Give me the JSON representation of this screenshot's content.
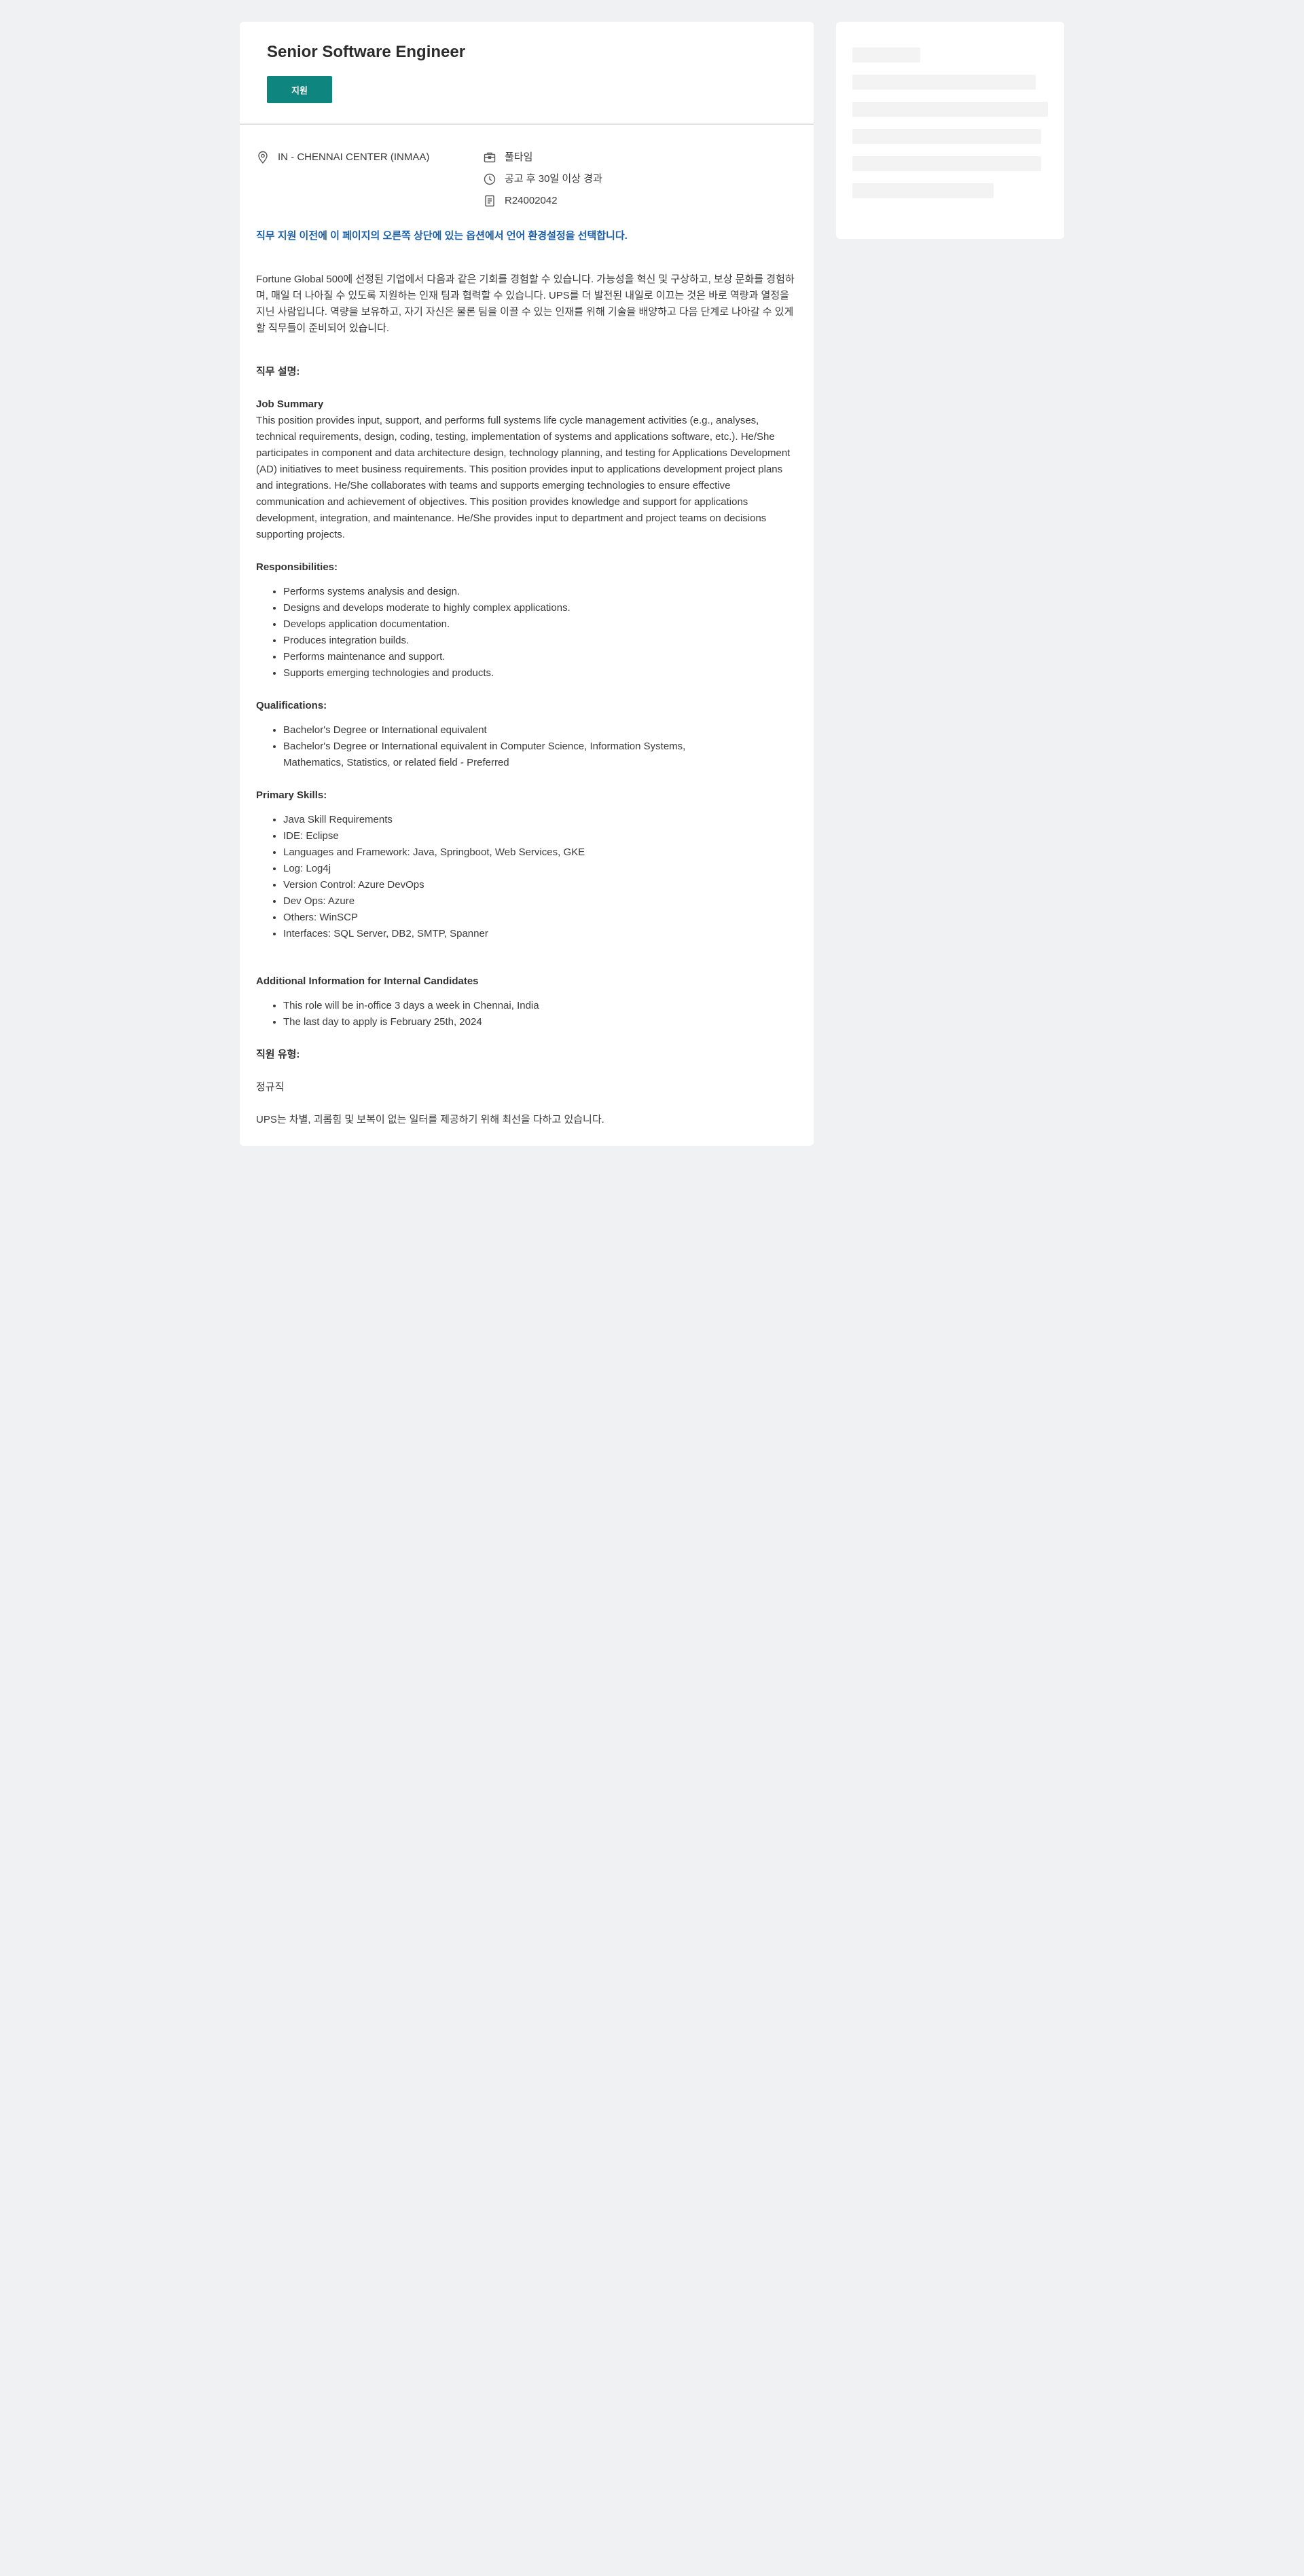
{
  "job": {
    "title": "Senior Software Engineer",
    "apply_label": "지원",
    "accent_color": "#0f857f",
    "location": "IN - CHENNAI CENTER (INMAA)",
    "time_type": "풀타임",
    "posted": "공고 후 30일 이상 경과",
    "requisition_id": "R24002042",
    "language_notice": "직무 지원 이전에 이 페이지의 오른쪽 상단에 있는 옵션에서 언어 환경설정을 선택합니다.",
    "intro": "Fortune Global 500에 선정된 기업에서 다음과 같은 기회를 경험할 수 있습니다. 가능성을 혁신 및 구상하고, 보상 문화를 경험하며, 매일 더 나아질 수 있도록 지원하는 인재 팀과 협력할 수 있습니다. UPS를 더 발전된 내일로 이끄는 것은 바로 역량과 열정을 지닌 사람입니다. 역량을 보유하고, 자기 자신은 물론 팀을 이끌 수 있는 인재를 위해 기술을 배양하고 다음 단계로 나아갈 수 있게 할 직무들이 준비되어 있습니다.",
    "description_heading": "직무 설명:",
    "summary_heading": "Job Summary",
    "summary_text": "This position provides input, support, and performs full systems life cycle management activities (e.g., analyses, technical requirements, design, coding, testing, implementation of systems and applications software, etc.). He/She participates in component and data architecture design, technology planning, and testing for Applications Development (AD) initiatives to meet business requirements. This position provides input to applications development project plans and integrations. He/She collaborates with teams and supports emerging technologies to ensure effective communication and achievement of objectives. This position provides knowledge and support for applications development, integration, and maintenance. He/She provides input to department and project teams on decisions supporting projects.",
    "responsibilities_heading": "Responsibilities:",
    "responsibilities": [
      "Performs systems analysis and design.",
      "Designs and develops moderate to highly complex applications.",
      "Develops application documentation.",
      "Produces integration builds.",
      "Performs maintenance and support.",
      "Supports emerging technologies and products."
    ],
    "qualifications_heading": "Qualifications:",
    "qualifications": [
      "Bachelor's Degree or International equivalent",
      "Bachelor's Degree or International equivalent in Computer Science, Information Systems, Mathematics, Statistics, or related field - Preferred"
    ],
    "skills_heading": "Primary Skills:",
    "skills": [
      "Java Skill Requirements",
      "IDE: Eclipse",
      "Languages and Framework: Java, Springboot, Web Services, GKE",
      "Log: Log4j",
      "Version Control: Azure DevOps",
      "Dev Ops: Azure",
      "Others: WinSCP",
      "Interfaces: SQL Server, DB2, SMTP, Spanner"
    ],
    "additional_heading": "Additional Information for Internal Candidates",
    "additional": [
      "This role will be in-office 3 days a week in Chennai, India",
      "The last day to apply is February 25th, 2024"
    ],
    "job_type_heading": "직원 유형:",
    "job_type": "정규직",
    "eeo": "UPS는 차별, 괴롭힘 및 보복이 없는 일터를 제공하기 위해 최선을 다하고 있습니다."
  }
}
